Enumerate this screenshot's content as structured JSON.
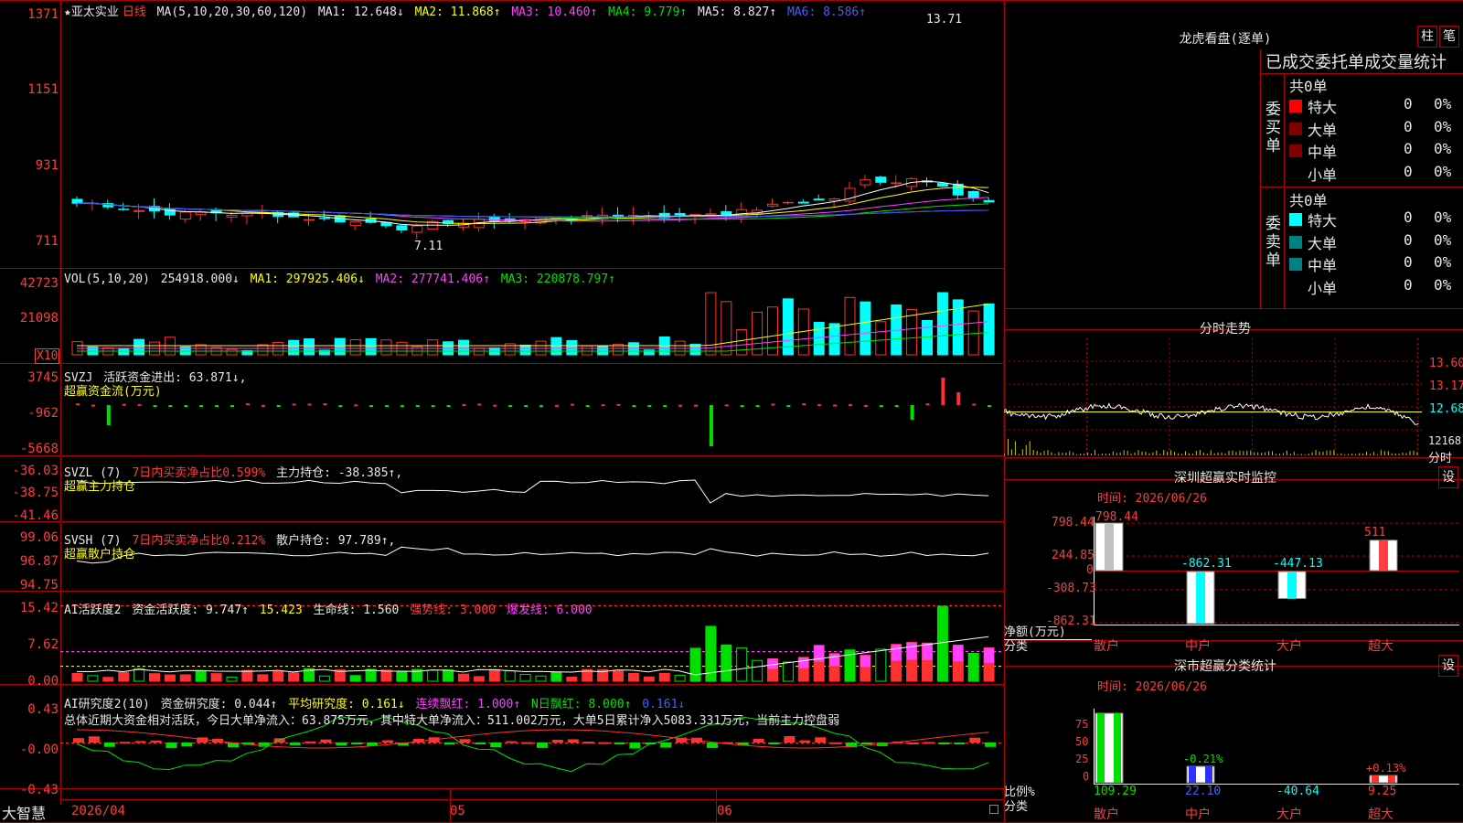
{
  "stock": {
    "name": "★亚太实业",
    "period": "日线",
    "ma_label": "MA(5,10,20,30,60,120)"
  },
  "price_panel": {
    "ma1": "MA1: 12.648↓",
    "ma2": "MA2: 11.868↑",
    "ma3": "MA3: 10.460↑",
    "ma4": "MA4: 9.779↑",
    "ma5": "MA5: 8.827↑",
    "ma6": "MA6: 8.586↑",
    "axis": [
      "1371",
      "1151",
      "931",
      "711"
    ],
    "high_label": "13.71",
    "low_label": "7.11"
  },
  "vol_panel": {
    "label": "VOL(5,10,20)",
    "value": "254918.000↓",
    "ma1": "MA1: 297925.406↓",
    "ma2": "MA2: 277741.406↑",
    "ma3": "MA3: 220878.797↑",
    "axis": [
      "42723",
      "21098"
    ],
    "unit": "X10"
  },
  "svzj_panel": {
    "label": "SVZJ",
    "value": "活跃资金进出: 63.871↓,",
    "sub": "超赢资金流(万元)",
    "axis": [
      "3745",
      "-962",
      "-5668"
    ]
  },
  "svzl_panel": {
    "label": "SVZL (7)",
    "desc": "7日内买卖净占比0.599%",
    "value": "主力持仓: -38.385↑,",
    "sub": "超赢主力持仓",
    "axis": [
      "-36.03",
      "-38.75",
      "-41.46"
    ]
  },
  "svsh_panel": {
    "label": "SVSH (7)",
    "desc": "7日内买卖净占比0.212%",
    "value": "散户持仓: 97.789↑,",
    "sub": "超赢散户持仓",
    "axis": [
      "99.06",
      "96.87",
      "94.75"
    ]
  },
  "ai_active_panel": {
    "label": "AI活跃度2",
    "v1": "资金活跃度: 9.747↑",
    "v2": "15.423",
    "v3": "生命线: 1.560",
    "v4": "强势线: 3.000",
    "v5": "爆发线: 6.000",
    "axis": [
      "15.42",
      "7.62",
      "0.00"
    ]
  },
  "ai_research_panel": {
    "label": "AI研究度2(10)",
    "v1": "资金研究度: 0.044↑",
    "v2": "平均研究度: 0.161↓",
    "v3": "连续飘红: 1.000↑",
    "v4": "N日飘红: 8.000↑",
    "v5": "0.161↓",
    "summary": "总体近期大资金相对活跃，今日大单净流入：63.875万元，其中特大单净流入：511.002万元，大单5日累计净入5083.331万元，当前主力控盘弱",
    "axis": [
      "0.43",
      "-0.00",
      "-0.43"
    ]
  },
  "bottom": {
    "brand": "大智慧",
    "date1": "2026/04",
    "date2": "05",
    "date3": "06"
  },
  "dragon": {
    "title": "龙虎看盘(逐单)",
    "btn1": "柱",
    "btn2": "笔",
    "header": "已成交委托单成交量统计",
    "buy": {
      "side": "委买单",
      "total": "共0单",
      "rows": [
        {
          "name": "特大",
          "n": "0",
          "p": "0%",
          "color": "#ff0000"
        },
        {
          "name": "大单",
          "n": "0",
          "p": "0%",
          "color": "#800000"
        },
        {
          "name": "中单",
          "n": "0",
          "p": "0%",
          "color": "#800000"
        },
        {
          "name": "小单",
          "n": "0",
          "p": "0%",
          "color": "#000000"
        }
      ]
    },
    "sell": {
      "side": "委卖单",
      "total": "共0单",
      "rows": [
        {
          "name": "特大",
          "n": "0",
          "p": "0%",
          "color": "#00ffff"
        },
        {
          "name": "大单",
          "n": "0",
          "p": "0%",
          "color": "#008080"
        },
        {
          "name": "中单",
          "n": "0",
          "p": "0%",
          "color": "#008080"
        },
        {
          "name": "小单",
          "n": "0",
          "p": "0%",
          "color": "#000000"
        }
      ]
    }
  },
  "intraday": {
    "title": "分时走势",
    "axis": [
      "13.60",
      "13.17",
      "12.68"
    ],
    "vol_axis": "12168",
    "unit": "分时"
  },
  "sz_monitor": {
    "title": "深圳超赢实时监控",
    "btn": "设",
    "time": "时间: 2026/06/26",
    "axis": [
      "798.44",
      "244.85",
      "0",
      "-308.73",
      "-862.31"
    ],
    "ylabel": "净额(万元)",
    "xlabel": "分类",
    "categories": [
      "散户",
      "中户",
      "大户",
      "超大"
    ],
    "values": [
      798.44,
      -862.31,
      -447.13,
      511
    ],
    "value_labels": [
      "798.44",
      "-862.31",
      "-447.13",
      "511"
    ]
  },
  "sz_stats": {
    "title": "深市超赢分类统计",
    "btn": "设",
    "time": "时间: 2026/06/26",
    "axis": [
      "75",
      "50",
      "25",
      "0"
    ],
    "ylabel": "比例%",
    "xlabel": "分类",
    "categories": [
      "散户",
      "中户",
      "大户",
      "超大"
    ],
    "values": [
      109.29,
      22.1,
      -40.64,
      9.25
    ],
    "top_labels": [
      "",
      "-0.21%",
      "",
      "+0.13%"
    ],
    "value_labels": [
      "109.29",
      "22.10",
      "-40.64",
      "9.25"
    ]
  }
}
